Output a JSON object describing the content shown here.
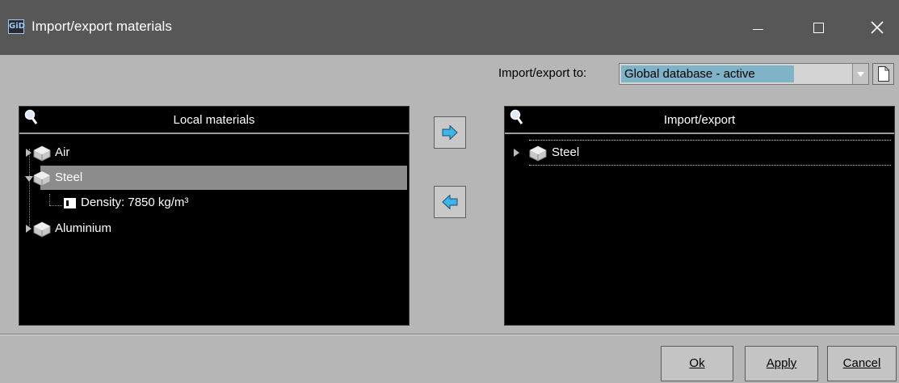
{
  "window": {
    "app_badge": "GiD",
    "title": "Import/export materials"
  },
  "io": {
    "label": "Import/export to:",
    "selected": "Global database - active"
  },
  "left_panel": {
    "header": "Local materials",
    "items": [
      {
        "label": "Air",
        "expanded": false
      },
      {
        "label": "Steel",
        "expanded": true,
        "selected": true
      },
      {
        "label": "Density: 7850 kg/m³",
        "type": "property"
      },
      {
        "label": "Aluminium",
        "expanded": false
      }
    ]
  },
  "right_panel": {
    "header": "Import/export",
    "items": [
      {
        "label": "Steel",
        "expanded": false
      }
    ]
  },
  "buttons": {
    "ok": "Ok",
    "apply": "Apply",
    "cancel": "Cancel"
  },
  "icons": {
    "search": "magnifier-icon",
    "material": "material-cube-icon",
    "export_right": "arrow-right-icon",
    "import_left": "arrow-left-icon",
    "new_file": "new-document-icon"
  },
  "colors": {
    "titlebar": "#575757",
    "background": "#b6b6b6",
    "panel": "#000000",
    "selection": "#8c8c8c",
    "combo_highlight": "#7fb3c7",
    "arrow": "#3fb4e8"
  }
}
